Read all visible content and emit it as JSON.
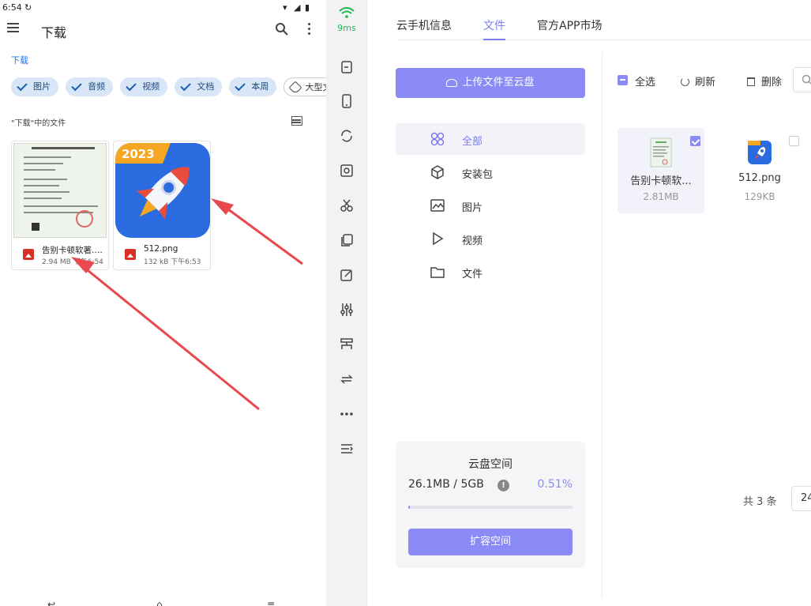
{
  "phone": {
    "status_time": "6:54",
    "app_title": "下载",
    "breadcrumb": "下载",
    "chips": [
      "图片",
      "音频",
      "视频",
      "文档",
      "本周"
    ],
    "chip_outline": "大型文件",
    "section_label": "\"下载\"中的文件",
    "files": [
      {
        "name": "告别卡顿软著.png",
        "meta": "2.94 MB 下午6:54"
      },
      {
        "name": "512.png",
        "meta": "132 kB 下午6:53"
      }
    ],
    "nav": [
      "↩",
      "⌂",
      "≡"
    ]
  },
  "sidebar": {
    "latency": "9ms",
    "icons": [
      "signal-icon",
      "file-icon",
      "phone-icon",
      "sync-icon",
      "screenshot-icon",
      "cut-icon",
      "clipboard-icon",
      "edit-icon",
      "settings-sliders-icon",
      "network-icon",
      "transfer-icon",
      "more-icon",
      "collapse-icon"
    ]
  },
  "panel": {
    "tabs": [
      "云手机信息",
      "文件",
      "官方APP市场"
    ],
    "upload_label": "上传文件至云盘",
    "categories": [
      "全部",
      "安装包",
      "图片",
      "视频",
      "文件"
    ],
    "storage": {
      "title": "云盘空间",
      "used": "26.1MB / 5GB",
      "info": "!",
      "percent": "0.51%",
      "fill_percent": 0.51,
      "expand_label": "扩容空间"
    },
    "toolbar": {
      "select_all": "全选",
      "refresh": "刷新",
      "delete": "删除"
    },
    "files": [
      {
        "name": "告别卡顿软...",
        "size": "2.81MB",
        "checked": true
      },
      {
        "name": "512.png",
        "size": "129KB",
        "checked": false
      }
    ],
    "total": "共 3 条",
    "page_size": "24"
  },
  "colors": {
    "accent": "#8b8bf5",
    "active_tab": "#7d7df0",
    "chip_bg": "#d8e6f7",
    "arrow": "#e8484e"
  }
}
